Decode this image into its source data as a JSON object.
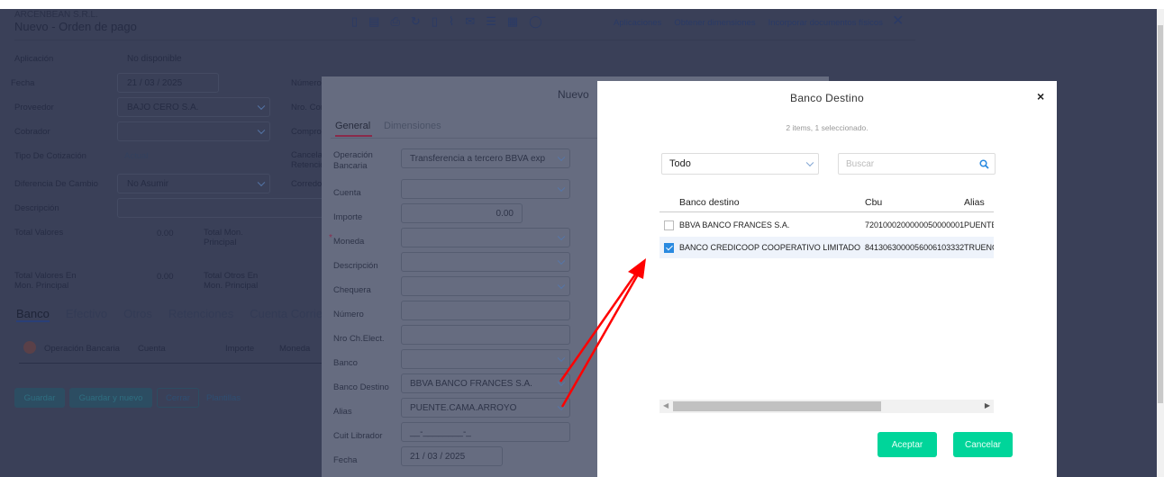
{
  "base": {
    "company": "ARCENBEAN S.R.L.",
    "title": "Nuevo - Orden de pago",
    "toolbar": {
      "links": [
        "Aplicaciones",
        "Obtener dimensiones",
        "Incorporar documentos físicos"
      ]
    },
    "fields": {
      "aplicacion_label": "Aplicación",
      "aplicacion_value": "No disponible",
      "fecha_label": "Fecha",
      "fecha_value": "21 / 03 / 2025",
      "proveedor_label": "Proveedor",
      "proveedor_value": "BAJO CERO S.A.",
      "cobrador_label": "Cobrador",
      "tipo_label": "Tipo De Cotización",
      "tipo_value": "Actual",
      "diferencia_label": "Diferencia De Cambio",
      "diferencia_value": "No Asumir",
      "descripcion_label": "Descripción",
      "numero_label": "Número",
      "nro_comp_label": "Nro. Cor",
      "comprob_label": "Comprob",
      "cancela_label": "Cancela Retencio",
      "corredor_label": "Corredo"
    },
    "totals": {
      "total_valores_label": "Total Valores",
      "total_valores": "0.00",
      "total_mon_label": "Total Mon. Principal",
      "total_valores_mon_label": "Total Valores En Mon. Principal",
      "total_valores_mon": "0.00",
      "total_otros_label": "Total Otros En Mon. Principal"
    },
    "tabs": [
      "Banco",
      "Efectivo",
      "Otros",
      "Retenciones",
      "Cuenta Corrien"
    ],
    "table_headers": [
      "Operación Bancaria",
      "Cuenta",
      "Importe",
      "Moneda"
    ],
    "buttons": {
      "guardar": "Guardar",
      "guardar_nuevo": "Guardar y nuevo",
      "cerrar": "Cerrar",
      "plantillas": "Plantillas"
    }
  },
  "mid": {
    "title": "Nuevo",
    "tabs": [
      "General",
      "Dimensiones"
    ],
    "fields": [
      {
        "label": "Operación Bancaria",
        "value": "Transferencia a tercero BBVA exp"
      },
      {
        "label": "Cuenta",
        "value": ""
      },
      {
        "label": "Importe",
        "value": "0.00"
      },
      {
        "label": "Moneda",
        "value": ""
      },
      {
        "label": "Descripción",
        "value": ""
      },
      {
        "label": "Chequera",
        "value": ""
      },
      {
        "label": "Número",
        "value": ""
      },
      {
        "label": "Nro Ch.Elect.",
        "value": ""
      },
      {
        "label": "Banco",
        "value": ""
      },
      {
        "label": "Banco Destino",
        "value": "BBVA BANCO FRANCES S.A."
      },
      {
        "label": "Alias",
        "value": "PUENTE.CAMA.ARROYO"
      },
      {
        "label": "Cuit Librador",
        "value": "__-________-_"
      },
      {
        "label": "Fecha",
        "value": "21 / 03 / 2025"
      }
    ]
  },
  "dialog": {
    "title": "Banco Destino",
    "status": "2 items, 1 seleccionado.",
    "filter": "Todo",
    "search_placeholder": "Buscar",
    "columns": [
      "Banco destino",
      "Cbu",
      "Alias"
    ],
    "rows": [
      {
        "banco": "BBVA BANCO FRANCES S.A.",
        "cbu": "7201000200000050000001",
        "alias": "PUENTE",
        "checked": false
      },
      {
        "banco": "BANCO CREDICOOP COOPERATIVO LIMITADO",
        "cbu": "8413063000056006103332",
        "alias": "TRUENO",
        "checked": true
      }
    ],
    "accept": "Aceptar",
    "cancel": "Cancelar",
    "close": "×"
  },
  "colors": {
    "accent": "#00d59a",
    "overlay": "#3a4058",
    "annotation": "#ff0000"
  }
}
